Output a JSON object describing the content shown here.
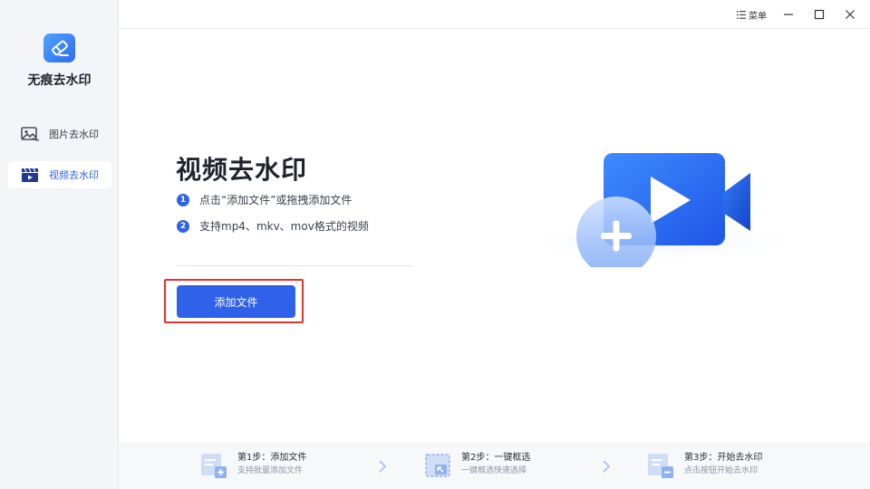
{
  "app": {
    "name": "无痕去水印"
  },
  "sidebar": {
    "items": [
      {
        "label": "图片去水印",
        "icon": "image-icon",
        "active": false
      },
      {
        "label": "视频去水印",
        "icon": "video-clapper-icon",
        "active": true
      }
    ]
  },
  "titlebar": {
    "menu_label": "菜单",
    "menu_icon": "list-icon"
  },
  "main": {
    "title": "视频去水印",
    "steps": [
      {
        "num": "1",
        "text": "点击“添加文件”或拖拽添加文件"
      },
      {
        "num": "2",
        "text": "支持mp4、mkv、mov格式的视频"
      }
    ],
    "add_button_label": "添加文件"
  },
  "bottom_steps": [
    {
      "title": "第1步：添加文件",
      "desc": "支持批量添加文件",
      "icon": "add-file-icon"
    },
    {
      "title": "第2步：一键框选",
      "desc": "一键框选快速选择",
      "icon": "select-area-icon"
    },
    {
      "title": "第3步：开始去水印",
      "desc": "点击按钮开始去水印",
      "icon": "remove-file-icon"
    }
  ],
  "colors": {
    "accent": "#2f62e8",
    "highlight": "#e4322b",
    "sidebar_bg": "#f4f5f8"
  }
}
